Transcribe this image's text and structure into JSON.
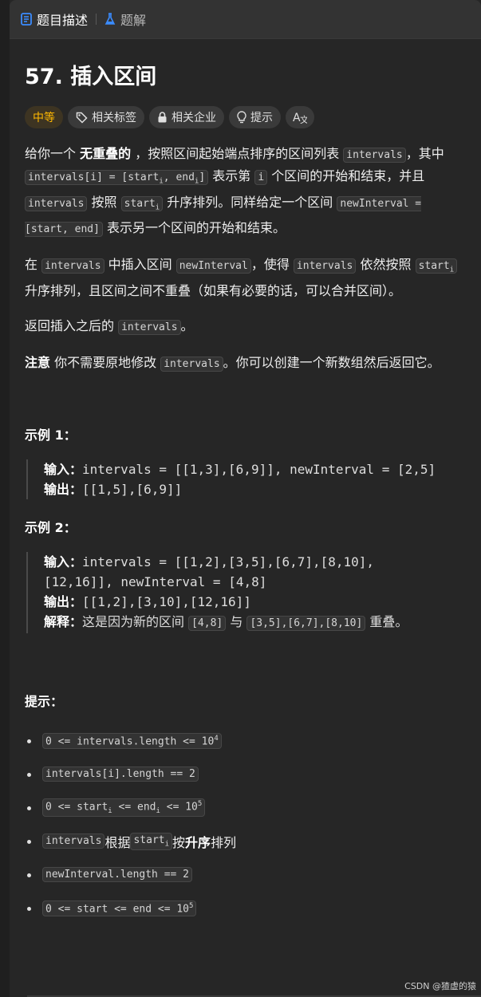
{
  "tabs": [
    {
      "label": "题目描述",
      "icon": "document-icon"
    },
    {
      "label": "题解",
      "icon": "flask-icon"
    }
  ],
  "title": "57. 插入区间",
  "tags": [
    {
      "label": "中等",
      "icon": ""
    },
    {
      "label": "相关标签",
      "icon": "tag-icon"
    },
    {
      "label": "相关企业",
      "icon": "lock-icon"
    },
    {
      "label": "提示",
      "icon": "lightbulb-icon"
    },
    {
      "label": "",
      "icon": "translate-icon"
    }
  ],
  "desc": {
    "p1_a": "给你一个 ",
    "p1_b": "无重叠的",
    "p1_c": " ，按照区间起始端点排序的区间列表 ",
    "p1_code1": "intervals",
    "p1_d": "，其中 ",
    "p1_code2a": "intervals[i] = [start",
    "p1_code2b": ", end",
    "p1_code2c": "]",
    "p1_e": " 表示第 ",
    "p1_code3": "i",
    "p1_f": " 个区间的开始和结束，并且 ",
    "p1_code4": "intervals",
    "p1_g": " 按照 ",
    "p1_code5": "start",
    "p1_h": " 升序排列。同样给定一个区间 ",
    "p1_code6": "newInterval = [start, end]",
    "p1_i": " 表示另一个区间的开始和结束。",
    "p2_a": "在 ",
    "p2_code1": "intervals",
    "p2_b": " 中插入区间 ",
    "p2_code2": "newInterval",
    "p2_c": "，使得 ",
    "p2_code3": "intervals",
    "p2_d": " 依然按照 ",
    "p2_code4": "start",
    "p2_e": " 升序排列，且区间之间不重叠（如果有必要的话，可以合并区间）。",
    "p3_a": "返回插入之后的 ",
    "p3_code": "intervals",
    "p3_b": "。",
    "p4_bold": "注意",
    "p4_a": " 你不需要原地修改 ",
    "p4_code": "intervals",
    "p4_b": "。你可以创建一个新数组然后返回它。",
    "sub_i": "i"
  },
  "examples": [
    {
      "title": "示例 1：",
      "input_label": "输入：",
      "input": "intervals = [[1,3],[6,9]], newInterval = [2,5]",
      "output_label": "输出：",
      "output": "[[1,5],[6,9]]"
    },
    {
      "title": "示例 2：",
      "input_label": "输入：",
      "input_1": "intervals = [[1,2],[3,5],[6,7],[8,10],",
      "input_2": "[12,16]], newInterval = [4,8]",
      "output_label": "输出：",
      "output": "[[1,2],[3,10],[12,16]]",
      "explain_label": "解释：",
      "explain_a": "这是因为新的区间 ",
      "explain_code1": "[4,8]",
      "explain_b": " 与 ",
      "explain_code2": "[3,5],[6,7],[8,10]",
      "explain_c": " 重叠。"
    }
  ],
  "hints_title": "提示：",
  "hints": {
    "h1": "0 <= intervals.length <= 10",
    "h1_sup": "4",
    "h2": "intervals[i].length == 2",
    "h3_a": "0 <= start",
    "h3_b": " <= end",
    "h3_c": " <= 10",
    "h3_sup": "5",
    "h4_code1": "intervals",
    "h4_a": " 根据 ",
    "h4_code2": "start",
    "h4_b": " 按 ",
    "h4_bold": "升序",
    "h4_c": " 排列",
    "h5": "newInterval.length == 2",
    "h6": "0 <= start <= end <= 10",
    "h6_sup": "5"
  },
  "watermark": "CSDN @猹虚的猿"
}
